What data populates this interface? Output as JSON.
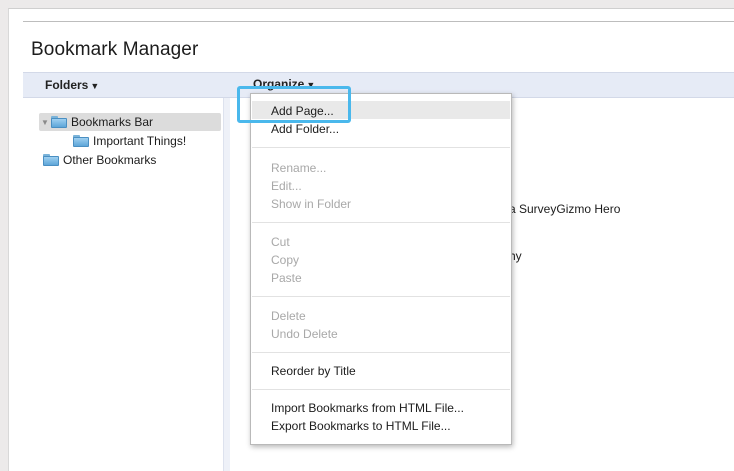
{
  "app": {
    "title": "Bookmark Manager"
  },
  "toolbar": {
    "folders_label": "Folders",
    "organize_label": "Organize"
  },
  "sidebar": {
    "items": [
      {
        "label": "Bookmarks Bar",
        "expanded": true,
        "selected": true
      },
      {
        "label": "Important Things!",
        "expanded": false,
        "selected": false
      },
      {
        "label": "Other Bookmarks",
        "expanded": false,
        "selected": false
      }
    ]
  },
  "content": {
    "partial_rows": [
      {
        "text": "a SurveyGizmo Hero"
      },
      {
        "text": "hy"
      }
    ]
  },
  "organize_menu": {
    "items": [
      {
        "label": "Add Page...",
        "enabled": true,
        "highlighted": true
      },
      {
        "label": "Add Folder...",
        "enabled": true
      },
      {
        "label": "Rename...",
        "enabled": false
      },
      {
        "label": "Edit...",
        "enabled": false
      },
      {
        "label": "Show in Folder",
        "enabled": false
      },
      {
        "label": "Cut",
        "enabled": false
      },
      {
        "label": "Copy",
        "enabled": false
      },
      {
        "label": "Paste",
        "enabled": false
      },
      {
        "label": "Delete",
        "enabled": false
      },
      {
        "label": "Undo Delete",
        "enabled": false
      },
      {
        "label": "Reorder by Title",
        "enabled": true
      },
      {
        "label": "Import Bookmarks from HTML File...",
        "enabled": true
      },
      {
        "label": "Export Bookmarks to HTML File...",
        "enabled": true
      }
    ]
  },
  "colors": {
    "highlight_outline": "#4ab8ec",
    "toolbar_bg": "#e6ebf6",
    "disabled_text": "#a8a8a8"
  }
}
